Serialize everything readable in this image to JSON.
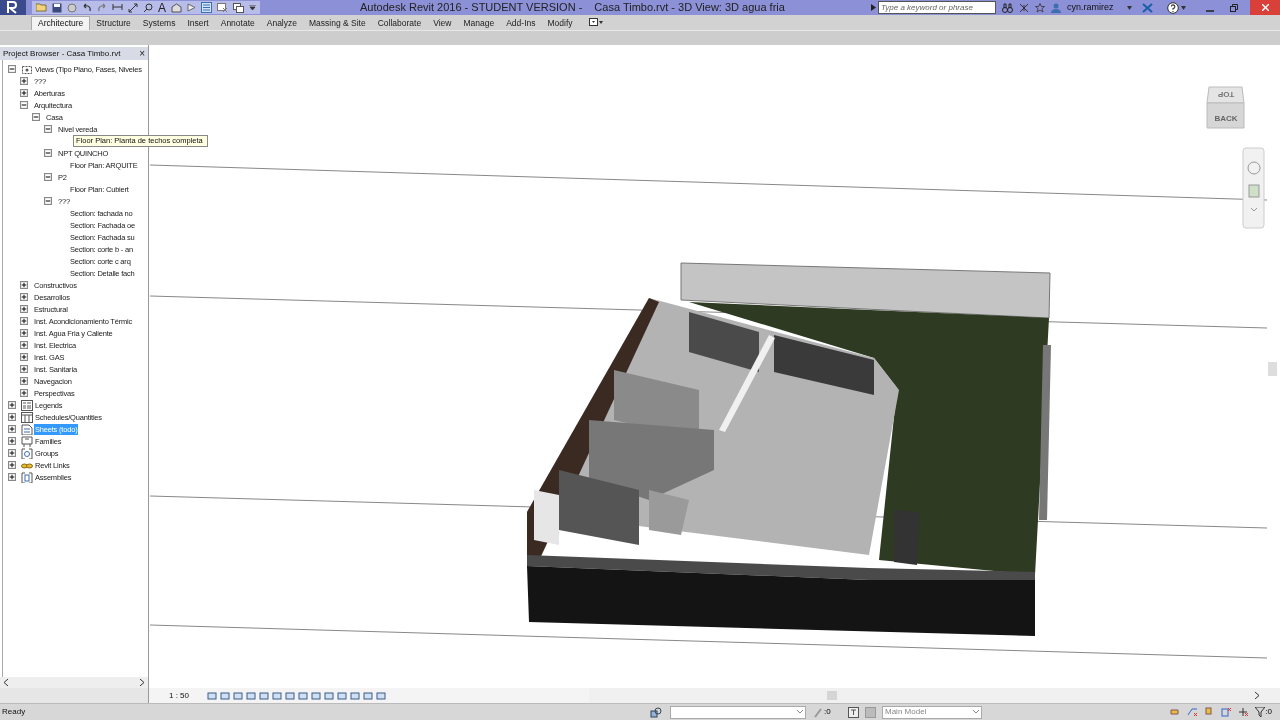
{
  "window": {
    "app_title": "Autodesk Revit 2016 - STUDENT VERSION -",
    "document_title": "Casa Timbo.rvt - 3D View: 3D agua fria"
  },
  "quick_access": {
    "text_tool": "A"
  },
  "search": {
    "placeholder": "Type a keyword or phrase"
  },
  "user": {
    "name": "cyn.ramirez"
  },
  "ribbon_tabs": [
    {
      "label": "Architecture",
      "selected": true
    },
    {
      "label": "Structure",
      "selected": false
    },
    {
      "label": "Systems",
      "selected": false
    },
    {
      "label": "Insert",
      "selected": false
    },
    {
      "label": "Annotate",
      "selected": false
    },
    {
      "label": "Analyze",
      "selected": false
    },
    {
      "label": "Massing & Site",
      "selected": false
    },
    {
      "label": "Collaborate",
      "selected": false
    },
    {
      "label": "View",
      "selected": false
    },
    {
      "label": "Manage",
      "selected": false
    },
    {
      "label": "Add-Ins",
      "selected": false
    },
    {
      "label": "Modify",
      "selected": false
    }
  ],
  "project_browser": {
    "title": "Project Browser - Casa Timbo.rvt",
    "close": "×",
    "tree": [
      {
        "label": "Views (Tipo Plano, Fases, Niveles",
        "kind": "views",
        "expanded": true,
        "selected": false,
        "children": [
          {
            "label": "???",
            "expanded": false,
            "selected": false
          },
          {
            "label": "Aberturas",
            "expanded": false,
            "selected": false
          },
          {
            "label": "Arquitectura",
            "expanded": true,
            "selected": false,
            "children": [
              {
                "label": "Casa",
                "expanded": true,
                "selected": false,
                "children": [
                  {
                    "label": "Nivel vereda",
                    "expanded": true,
                    "selected": false
                  },
                  {
                    "label": "NPT QUINCHO",
                    "expanded": true,
                    "selected": false,
                    "children": [
                      {
                        "label": "Floor Plan: ARQUITE",
                        "selected": false
                      }
                    ]
                  },
                  {
                    "label": "P2",
                    "expanded": true,
                    "selected": false,
                    "children": [
                      {
                        "label": "Floor Plan: Cubiert",
                        "selected": false
                      }
                    ]
                  },
                  {
                    "label": "???",
                    "expanded": true,
                    "selected": false,
                    "children": [
                      {
                        "label": "Section: fachada no",
                        "selected": false
                      },
                      {
                        "label": "Section: Fachada oe",
                        "selected": false
                      },
                      {
                        "label": "Section: Fachada su",
                        "selected": false
                      },
                      {
                        "label": "Section: corte b - an",
                        "selected": false
                      },
                      {
                        "label": "Section: corte c arq",
                        "selected": false
                      },
                      {
                        "label": "Section: Detalle fach",
                        "selected": false
                      }
                    ]
                  }
                ]
              }
            ]
          },
          {
            "label": "Constructivos",
            "expanded": false,
            "selected": false
          },
          {
            "label": "Desarrollos",
            "expanded": false,
            "selected": false
          },
          {
            "label": "Estructural",
            "expanded": false,
            "selected": false
          },
          {
            "label": "Inst. Acondicionamiento Térmic",
            "expanded": false,
            "selected": false
          },
          {
            "label": "Inst. Agua Fria y Caliente",
            "expanded": false,
            "selected": false
          },
          {
            "label": "Inst. Electrica",
            "expanded": false,
            "selected": false
          },
          {
            "label": "Inst. GAS",
            "expanded": false,
            "selected": false
          },
          {
            "label": "Inst. Sanitaria",
            "expanded": false,
            "selected": false
          },
          {
            "label": "Navegacion",
            "expanded": false,
            "selected": false
          },
          {
            "label": "Perspectivas",
            "expanded": false,
            "selected": false
          }
        ]
      },
      {
        "label": "Legends",
        "kind": "legends",
        "expanded": false,
        "selected": false
      },
      {
        "label": "Schedules/Quantities",
        "kind": "schedules",
        "expanded": false,
        "selected": false
      },
      {
        "label": "Sheets (todo)",
        "kind": "sheets",
        "expanded": false,
        "selected": true
      },
      {
        "label": "Families",
        "kind": "families",
        "expanded": false,
        "selected": false
      },
      {
        "label": "Groups",
        "kind": "groups",
        "expanded": false,
        "selected": false
      },
      {
        "label": "Revit Links",
        "kind": "links",
        "expanded": false,
        "selected": false
      },
      {
        "label": "Assemblies",
        "kind": "assemblies",
        "expanded": false,
        "selected": false
      }
    ]
  },
  "tooltip": {
    "text": "Floor Plan: Planta de techos completa"
  },
  "view": {
    "viewcube": {
      "top": "TOP",
      "back": "BACK"
    },
    "scale": "1 : 50"
  },
  "status_bar": {
    "message": "Ready",
    "editing_count": ":0",
    "workset": "Main Model",
    "filter_count": ":0"
  }
}
